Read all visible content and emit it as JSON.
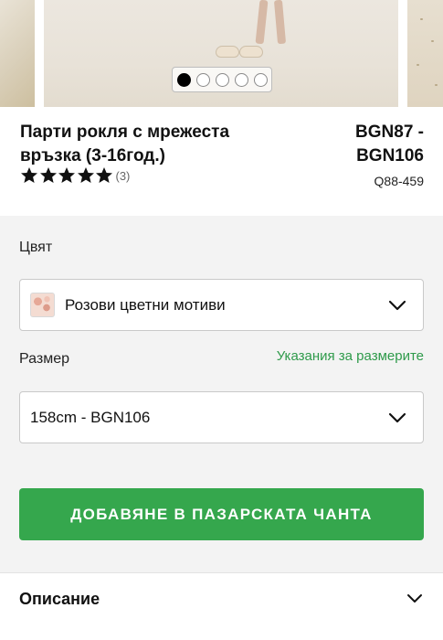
{
  "carousel": {
    "slide_count": 5,
    "active_slide": 1
  },
  "product": {
    "title": "Парти рокля с мрежеста връзка (3-16год.)",
    "price": "BGN87 - BGN106",
    "sku": "Q88-459",
    "rating_stars": 5,
    "rating_count": "(3)"
  },
  "colour": {
    "label": "Цвят",
    "selected": "Розови цветни мотиви"
  },
  "size": {
    "label": "Размер",
    "guide_link": "Указания за размерите",
    "selected": "158cm - BGN106"
  },
  "actions": {
    "add_to_bag": "ДОБАВЯНЕ В ПАЗАРСКАТА ЧАНТА"
  },
  "description": {
    "title": "Описание"
  },
  "colors": {
    "accent": "#35a74d",
    "link": "#2e9a4a"
  }
}
